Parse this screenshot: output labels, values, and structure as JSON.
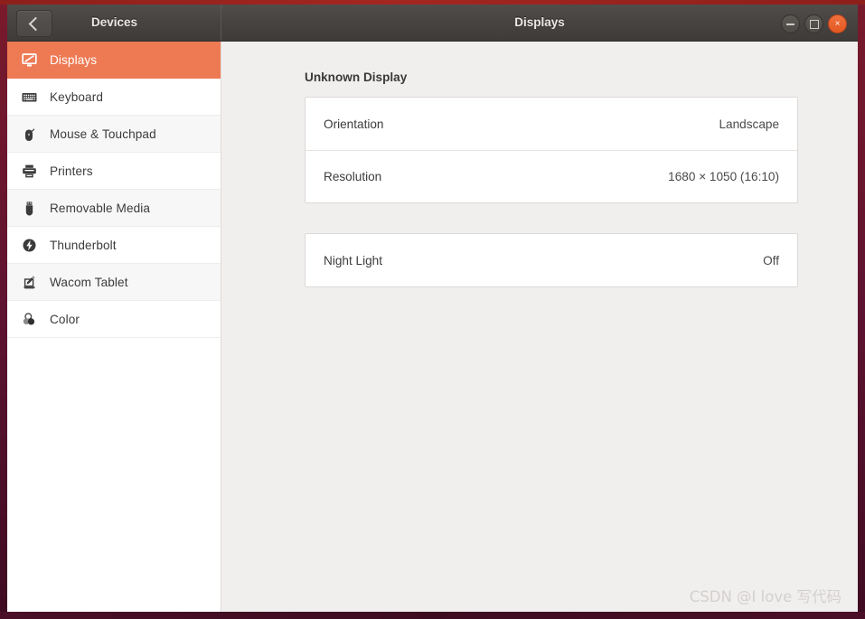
{
  "window": {
    "sidebar_title": "Devices",
    "main_title": "Displays",
    "back_label": "‹",
    "controls": {
      "minimize": "minimize-button",
      "maximize": "maximize-button",
      "close": "×"
    }
  },
  "sidebar": {
    "items": [
      {
        "label": "Displays",
        "icon": "display-icon",
        "active": true
      },
      {
        "label": "Keyboard",
        "icon": "keyboard-icon",
        "active": false
      },
      {
        "label": "Mouse & Touchpad",
        "icon": "mouse-icon",
        "active": false
      },
      {
        "label": "Printers",
        "icon": "printer-icon",
        "active": false
      },
      {
        "label": "Removable Media",
        "icon": "usb-drive-icon",
        "active": false
      },
      {
        "label": "Thunderbolt",
        "icon": "thunderbolt-icon",
        "active": false
      },
      {
        "label": "Wacom Tablet",
        "icon": "wacom-tablet-icon",
        "active": false
      },
      {
        "label": "Color",
        "icon": "color-circles-icon",
        "active": false
      }
    ]
  },
  "main": {
    "heading": "Unknown Display",
    "display_rows": [
      {
        "label": "Orientation",
        "value": "Landscape"
      },
      {
        "label": "Resolution",
        "value": "1680 × 1050 (16:10)"
      }
    ],
    "nightlight_row": {
      "label": "Night Light",
      "value": "Off"
    }
  },
  "watermark": "CSDN @I love 写代码",
  "colors": {
    "accent_orange": "#ee7a54",
    "close_button": "#e25822",
    "frame_maroon": "#5d1233",
    "titlebar_dark": "#474441",
    "content_bg": "#f1efee"
  }
}
